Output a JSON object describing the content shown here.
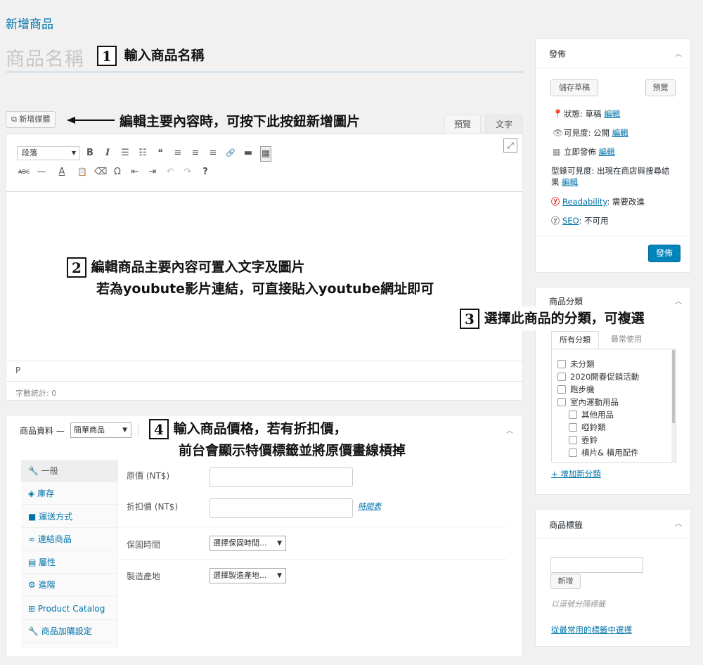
{
  "page": {
    "heading": "新增商品",
    "title_placeholder": "商品名稱"
  },
  "annotations": [
    {
      "num": "1",
      "text": "輸入商品名稱"
    },
    {
      "text": "編輯主要內容時，可按下此按鈕新增圖片"
    },
    {
      "num": "2",
      "line1": "編輯商品主要內容可置入文字及圖片",
      "line2": "若為youbute影片連結，可直接貼入youtube網址即可"
    },
    {
      "num": "3",
      "text": "選擇此商品的分類，可複選"
    },
    {
      "num": "4",
      "line1": "輸入商品價格，若有折扣價，",
      "line2": "前台會顯示特價標籤並將原價畫線槓掉"
    }
  ],
  "editor": {
    "add_media_label": "新增媒體",
    "tabs": [
      "預覽",
      "文字"
    ],
    "format_select": "段落",
    "toolbar_row1": [
      "B",
      "I",
      "☰",
      "☷",
      "❝",
      "≡",
      "≡",
      "≡",
      "🔗",
      "▬",
      "▦"
    ],
    "toolbar_row2": [
      "ABC",
      "—",
      "A",
      "📋",
      "⌫",
      "Ω",
      "⇤",
      "⇥",
      "↶",
      "↷",
      "?"
    ],
    "path": "P",
    "word_count": "字數統計: 0"
  },
  "publish": {
    "title": "發佈",
    "save_draft": "儲存草稿",
    "preview": "預覽",
    "status_label": "狀態: 草稿",
    "visibility_label": "可見度: 公開",
    "schedule_label": "立即發佈",
    "catalog_label": "型錄可見度: 出現在商店與搜尋結",
    "catalog_label2": "果",
    "edit": "編輯",
    "readability_link": "Readability",
    "readability_value": ": 需要改進",
    "seo_link": "SEO",
    "seo_value": ": 不可用",
    "publish_button": "發佈"
  },
  "categories": {
    "title": "商品分類",
    "tab_all": "所有分類",
    "tab_common": "最常使用",
    "items": [
      "未分類",
      "2020開春促銷活動",
      "跑步機",
      "室內運動用品",
      "其他用品",
      "啞鈴類",
      "壺鈴",
      "槓片& 槓用配件"
    ],
    "add_link": "+ 增加新分類"
  },
  "tags": {
    "title": "商品標籤",
    "add_button": "新增",
    "hint": "以逗號分隔標籤",
    "choose_link": "從最常用的標籤中選擇"
  },
  "product_data": {
    "label": "商品資料 —",
    "type_select": "簡單商品",
    "tabs": [
      "一般",
      "庫存",
      "運送方式",
      "連結商品",
      "屬性",
      "進階",
      "Product Catalog",
      "商品加購設定"
    ],
    "regular_price_label": "原價 (NT$)",
    "sale_price_label": "折扣價 (NT$)",
    "schedule_link": "時間表",
    "warranty_label": "保固時間",
    "warranty_select": "選擇保固時間...",
    "origin_label": "製造產地",
    "origin_select": "選擇製造產地..."
  }
}
